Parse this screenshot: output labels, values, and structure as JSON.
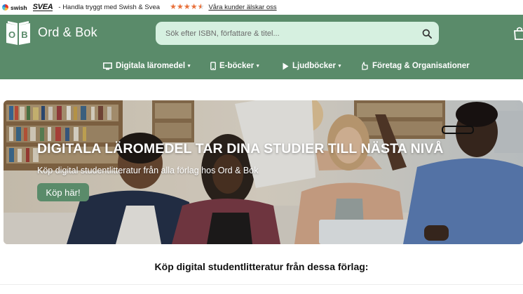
{
  "topbar": {
    "swish": "swish",
    "svea": "SVEA",
    "tagline": "- Handla tryggt med Swish & Svea",
    "rating": 4.5,
    "rating_color": "#e8703a",
    "reviews_link": "Våra kunder älskar oss"
  },
  "header": {
    "bg_color": "#5a8b6a",
    "logo_text": "Ord & Bok",
    "search_placeholder": "Sök efter ISBN, författare & titel...",
    "search_icon": "search-icon",
    "cart_icon": "cart-icon"
  },
  "nav": {
    "items": [
      {
        "label": "Digitala läromedel",
        "icon": "monitor-icon",
        "has_dropdown": true
      },
      {
        "label": "E-böcker",
        "icon": "phone-icon",
        "has_dropdown": true
      },
      {
        "label": "Ljudböcker",
        "icon": "play-icon",
        "has_dropdown": true
      },
      {
        "label": "Företag & Organisationer",
        "icon": "handshake-icon",
        "has_dropdown": false
      }
    ]
  },
  "hero": {
    "title": "DIGITALA LÄROMEDEL TAR DINA STUDIER TILL NÄSTA NIVÅ",
    "subtitle": "Köp digital studentlitteratur från alla förlag hos Ord & Bok",
    "button": "Köp här!"
  },
  "section": {
    "title": "Köp digital studentlitteratur från dessa förlag:"
  }
}
